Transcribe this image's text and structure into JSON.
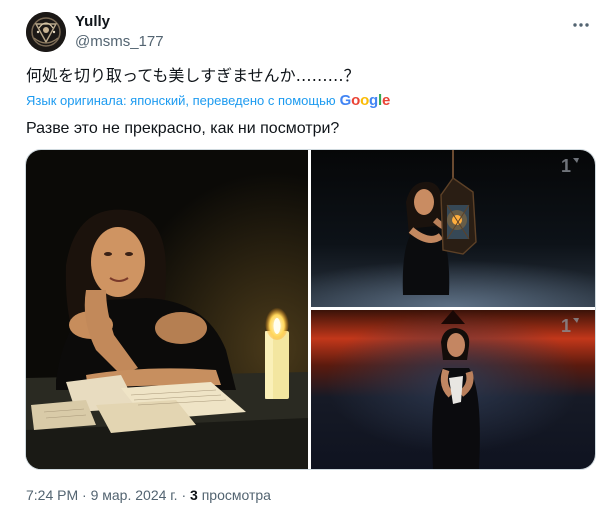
{
  "author": {
    "display_name": "Yully",
    "handle": "@msms_177",
    "avatar_icon": "avatar-image"
  },
  "tweet": {
    "original_text": "何処を切り取っても美しすぎませんか………？",
    "translation_notice": "Язык оригинала: японский, переведено с помощью",
    "translation_provider": [
      "G",
      "o",
      "o",
      "g",
      "l",
      "e"
    ],
    "translated_text": "Разве это не прекрасно, как ни посмотри?"
  },
  "media": {
    "photos": [
      {
        "name": "photo-woman-at-desk-with-candle",
        "watermark": ""
      },
      {
        "name": "photo-woman-holding-lantern",
        "watermark": "1"
      },
      {
        "name": "photo-woman-on-stage-red-sky",
        "watermark": "1"
      }
    ]
  },
  "meta": {
    "time": "7:24 PM",
    "separator": " · ",
    "date": "9 мар. 2024 г.",
    "views_count": "3",
    "views_label": " просмотра"
  },
  "colors": {
    "link_blue": "#1d9bf0",
    "secondary_text": "#536471",
    "primary_text": "#0f1419",
    "border": "#cfd9de"
  }
}
